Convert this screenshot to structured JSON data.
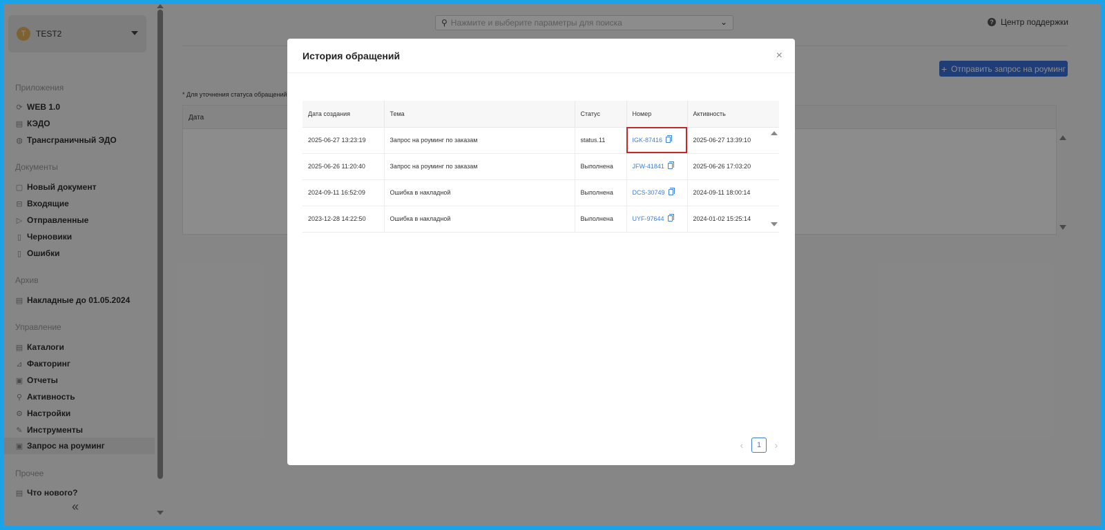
{
  "sidebar": {
    "account": {
      "initial": "T",
      "name": "TEST2"
    },
    "sections": {
      "apps": "Приложения",
      "docs": "Документы",
      "archive": "Архив",
      "manage": "Управление",
      "other": "Прочее"
    },
    "apps": [
      "WEB 1.0",
      "КЭДО",
      "Трансграничный ЭДО"
    ],
    "docs": [
      "Новый документ",
      "Входящие",
      "Отправленные",
      "Черновики",
      "Ошибки"
    ],
    "archive": [
      "Накладные до 01.05.2024"
    ],
    "manage": [
      "Каталоги",
      "Факторинг",
      "Отчеты",
      "Активность",
      "Настройки",
      "Инструменты",
      "Запрос на роуминг"
    ],
    "other": [
      "Что нового?"
    ],
    "collapse_glyph": "«"
  },
  "header": {
    "search_placeholder": "Нажмите и выберите параметры для поиска",
    "support_label": "Центр поддержки"
  },
  "main": {
    "roaming_button": "Отправить запрос на роуминг",
    "note": "* Для уточнения статуса обращений",
    "table_header_date": "Дата"
  },
  "modal": {
    "title": "История обращений",
    "close_glyph": "×",
    "columns": [
      "Дата создания",
      "Тема",
      "Статус",
      "Номер",
      "Активность"
    ],
    "rows": [
      {
        "created": "2025-06-27 13:23:19",
        "topic": "Запрос на роуминг по заказам",
        "status": "status.11",
        "number": "IGK-87416",
        "activity": "2025-06-27 13:39:10"
      },
      {
        "created": "2025-06-26 11:20:40",
        "topic": "Запрос на роуминг по заказам",
        "status": "Выполнена",
        "number": "JFW-41841",
        "activity": "2025-06-26 17:03:20"
      },
      {
        "created": "2024-09-11 16:52:09",
        "topic": "Ошибка в накладной",
        "status": "Выполнена",
        "number": "DCS-30749",
        "activity": "2024-09-11 18:00:14"
      },
      {
        "created": "2023-12-28 14:22:50",
        "topic": "Ошибка в накладной",
        "status": "Выполнена",
        "number": "UYF-97644",
        "activity": "2024-01-02 15:25:14"
      }
    ],
    "pagination": {
      "current": "1",
      "prev_glyph": "‹",
      "next_glyph": "›"
    }
  },
  "colors": {
    "accent": "#3a6fd8",
    "link": "#3c7fd6",
    "highlight": "#c62828",
    "frame": "#1aa3e8"
  }
}
